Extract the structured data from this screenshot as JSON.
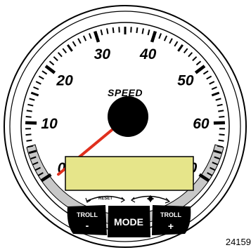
{
  "gauge": {
    "title": "SPEED",
    "scale_labels": [
      "0",
      "10",
      "20",
      "30",
      "40",
      "50",
      "60",
      "70"
    ],
    "scale_min": 0,
    "scale_max": 70,
    "needle_value": 0,
    "lcd_color": "#e6e58a"
  },
  "controls": {
    "reset_label": "RESET",
    "settings_icon": "gear-icon",
    "troll_minus_label": "TROLL",
    "troll_minus_sign": "-",
    "mode_label": "MODE",
    "troll_plus_label": "TROLL",
    "troll_plus_sign": "+"
  },
  "figure_number": "24159",
  "colors": {
    "needle": "#e0301e",
    "bezel": "#ffffff",
    "button": "#000000"
  }
}
